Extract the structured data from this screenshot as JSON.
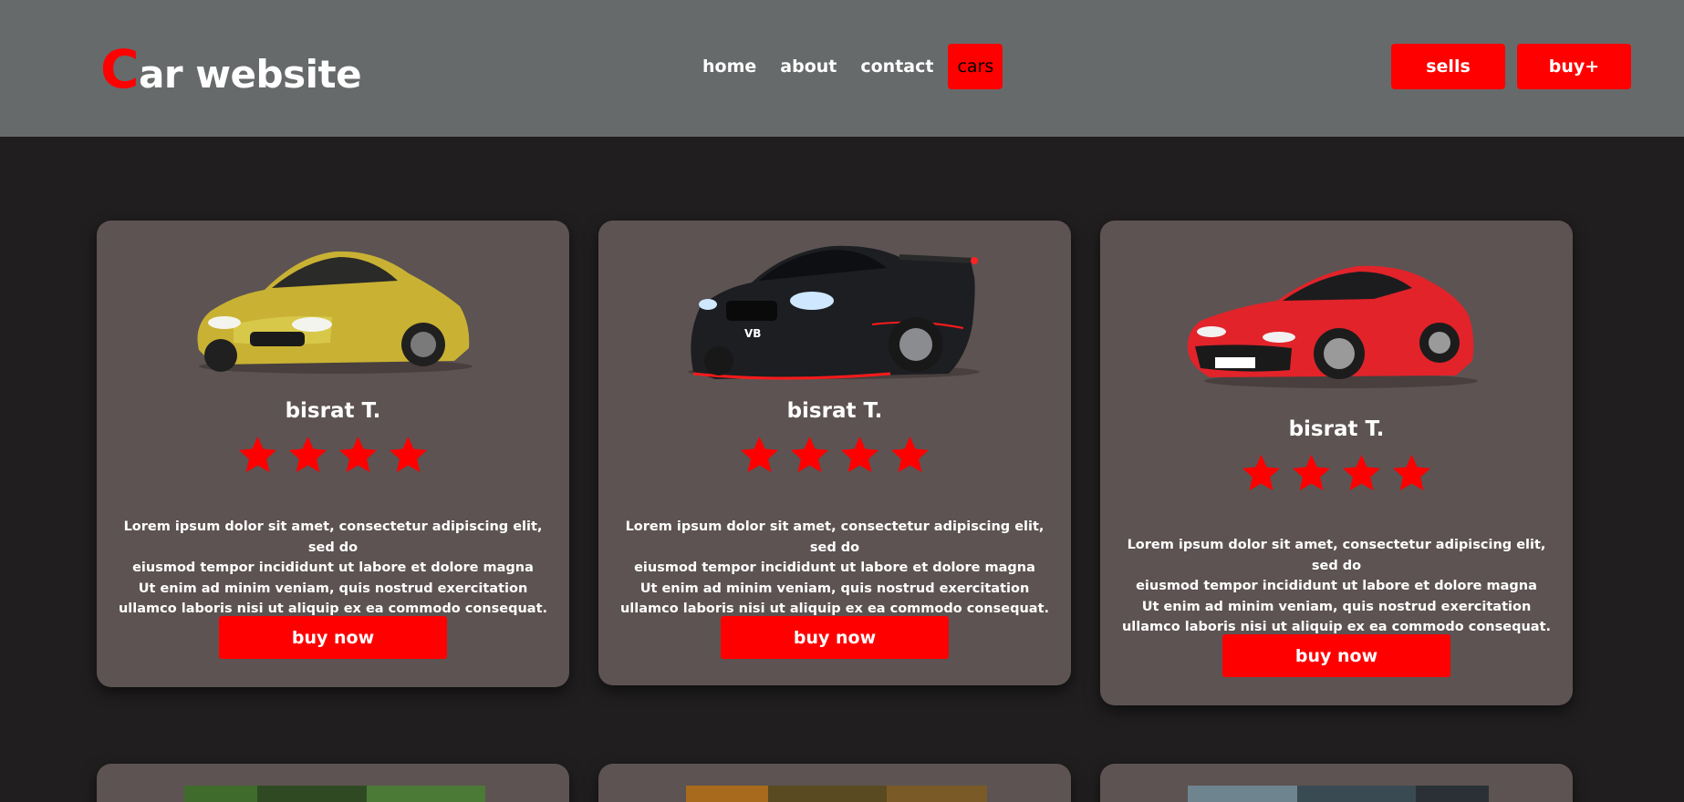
{
  "header": {
    "logo_first": "C",
    "logo_rest": "ar website",
    "nav": [
      "home",
      "about",
      "contact",
      "cars"
    ],
    "active_nav": "cars",
    "sells_label": "sells",
    "buy_label": "buy+"
  },
  "cards": [
    {
      "car": "yellow-sports-car",
      "owner": "bisrat T.",
      "rating": 4,
      "description": "Lorem ipsum dolor sit amet, consectetur adipiscing elit, sed do\neiusmod tempor incididunt ut labore et dolore magna\nUt enim ad minim veniam, quis nostrud exercitation\nullamco laboris nisi ut aliquip ex ea commodo consequat.",
      "button": "buy now"
    },
    {
      "car": "black-tuned-car",
      "owner": "bisrat T.",
      "rating": 4,
      "description": "Lorem ipsum dolor sit amet, consectetur adipiscing elit, sed do\neiusmod tempor incididunt ut labore et dolore magna\nUt enim ad minim veniam, quis nostrud exercitation\nullamco laboris nisi ut aliquip ex ea commodo consequat.",
      "button": "buy now"
    },
    {
      "car": "red-electric-car",
      "owner": "bisrat T.",
      "rating": 4,
      "description": "Lorem ipsum dolor sit amet, consectetur adipiscing elit, sed do\neiusmod tempor incididunt ut labore et dolore magna\nUt enim ad minim veniam, quis nostrud exercitation\nullamco laboris nisi ut aliquip ex ea commodo consequat.",
      "button": "buy now"
    }
  ],
  "colors": {
    "accent": "#ff0000",
    "header_bg": "#666a6b",
    "page_bg": "#201e1f",
    "card_bg": "#5d5352"
  }
}
